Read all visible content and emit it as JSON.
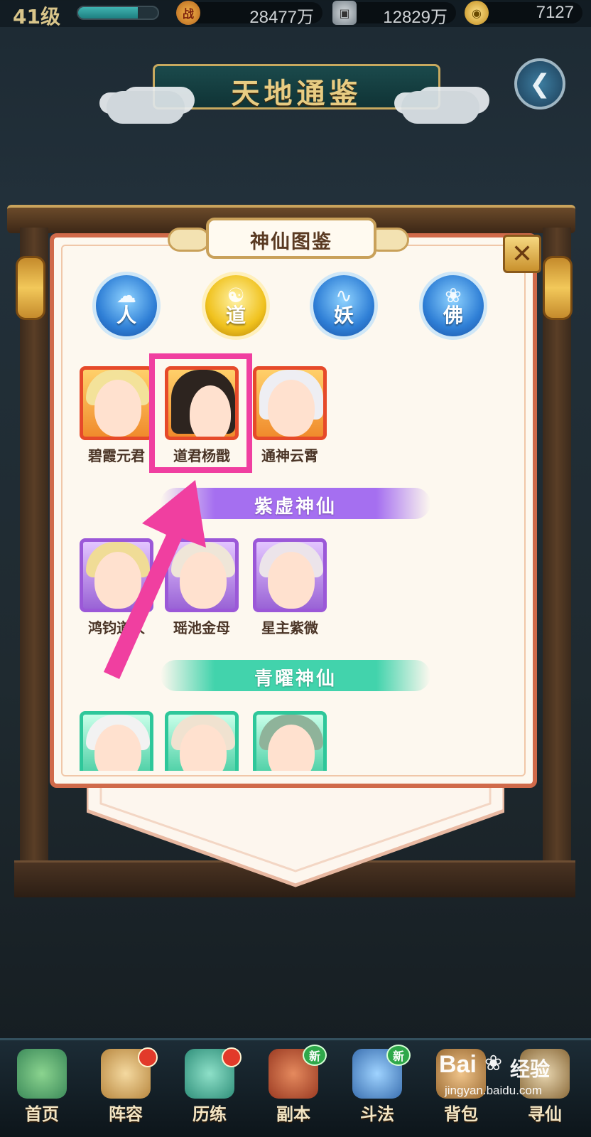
{
  "top_bar": {
    "level": "41级",
    "level_progress": 0.75,
    "combat_power": "28477万",
    "silver": "12829万",
    "gold": "7127"
  },
  "banner": {
    "title": "天地通鉴"
  },
  "panel": {
    "title": "神仙图鉴"
  },
  "tabs": [
    {
      "label": "人",
      "symbol": "☁",
      "selected": false
    },
    {
      "label": "道",
      "symbol": "☯",
      "selected": true
    },
    {
      "label": "妖",
      "symbol": "∿",
      "selected": false
    },
    {
      "label": "佛",
      "symbol": "❀",
      "selected": false
    }
  ],
  "row1": [
    {
      "name": "碧霞元君",
      "rarity": "orange",
      "hair": "#f3e29a"
    },
    {
      "name": "道君杨戬",
      "rarity": "orange",
      "hair": "#2d241f"
    },
    {
      "name": "通神云霄",
      "rarity": "orange",
      "hair": "#eeeef3"
    }
  ],
  "sections": {
    "purple": "紫虚神仙",
    "teal": "青曜神仙"
  },
  "row2": [
    {
      "name": "鸿钧道人",
      "rarity": "purple",
      "hair": "#f0dc96"
    },
    {
      "name": "瑶池金母",
      "rarity": "purple",
      "hair": "#efe6d8"
    },
    {
      "name": "星主紫微",
      "rarity": "purple",
      "hair": "#ece4ea"
    }
  ],
  "row3": [
    {
      "name": "",
      "rarity": "green",
      "hair": "#f2f2f2"
    },
    {
      "name": "",
      "rarity": "green",
      "hair": "#f0e2d0"
    },
    {
      "name": "",
      "rarity": "green",
      "hair": "#8fb39a"
    }
  ],
  "bottom_nav": [
    {
      "label": "首页",
      "badge": ""
    },
    {
      "label": "阵容",
      "badge": "dot"
    },
    {
      "label": "历练",
      "badge": "dot"
    },
    {
      "label": "副本",
      "badge": "新"
    },
    {
      "label": "斗法",
      "badge": "新"
    },
    {
      "label": "背包",
      "badge": ""
    },
    {
      "label": "寻仙",
      "badge": ""
    }
  ],
  "watermark": {
    "logo": "Bai",
    "logo_suffix": "经验",
    "url": "jingyan.baidu.com"
  },
  "colors": {
    "highlight": "#f03fa0",
    "panel_border": "#d06a4a"
  }
}
